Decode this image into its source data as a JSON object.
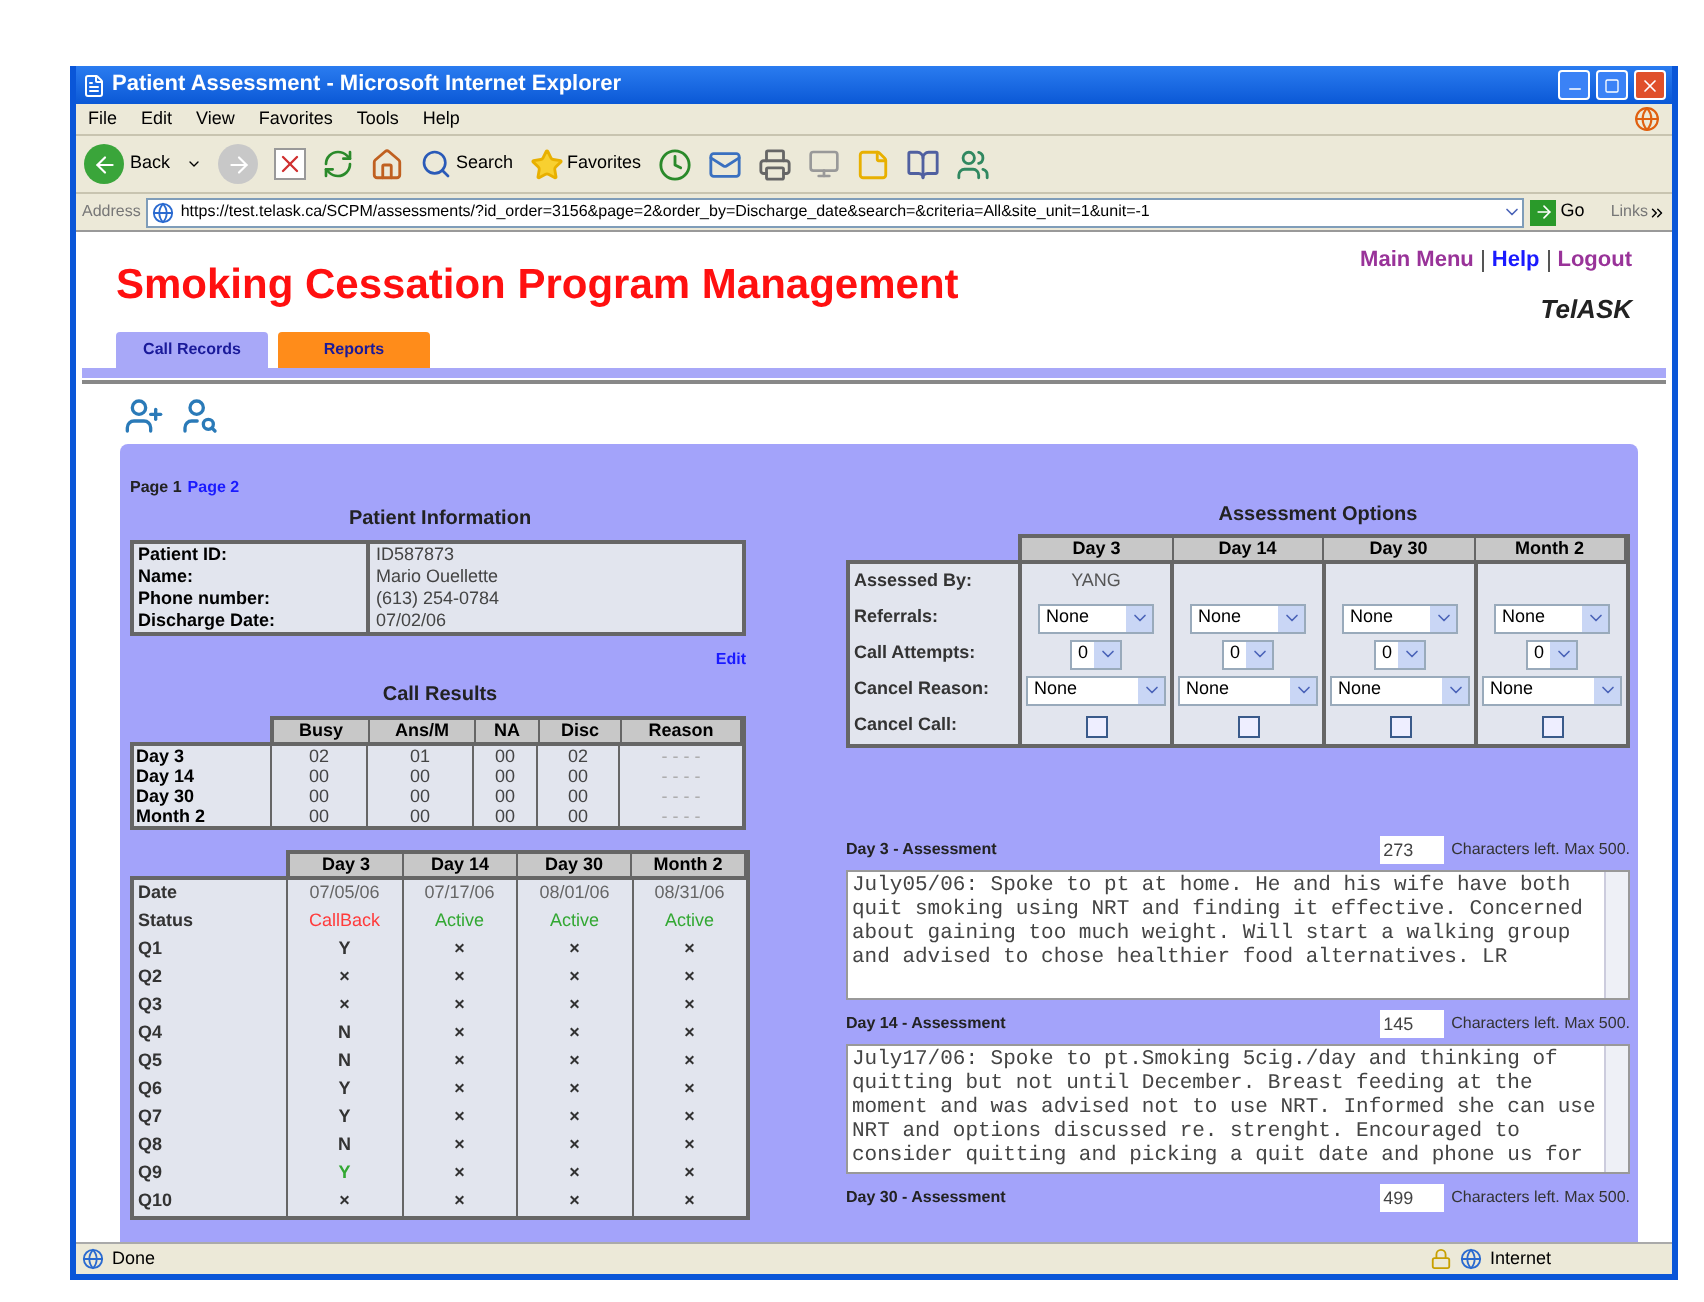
{
  "window": {
    "title": "Patient Assessment - Microsoft Internet Explorer"
  },
  "menu": [
    "File",
    "Edit",
    "View",
    "Favorites",
    "Tools",
    "Help"
  ],
  "toolbar": {
    "back": "Back",
    "search": "Search",
    "favorites": "Favorites"
  },
  "address_bar": {
    "label": "Address",
    "url": "https://test.telask.ca/SCPM/assessments/?id_order=3156&page=2&order_by=Discharge_date&search=&criteria=All&site_unit=1&unit=-1",
    "go": "Go",
    "links": "Links"
  },
  "app": {
    "title": "Smoking Cessation Program Management",
    "links": [
      {
        "label": "Main Menu",
        "visited": true
      },
      {
        "label": "Help",
        "visited": false
      },
      {
        "label": "Logout",
        "visited": true
      }
    ],
    "logo": "TelASK"
  },
  "tabs": [
    {
      "label": "Call Records",
      "selected": true
    },
    {
      "label": "Reports",
      "selected": false
    }
  ],
  "pager": [
    {
      "label": "Page 1",
      "selected": true
    },
    {
      "label": "Page 2",
      "selected": false
    }
  ],
  "patient_info": {
    "title": "Patient Information",
    "fields": [
      {
        "label": "Patient ID:",
        "value": "ID587873"
      },
      {
        "label": "Name:",
        "value": "Mario Ouellette"
      },
      {
        "label": "Phone number:",
        "value": "(613) 254-0784"
      },
      {
        "label": "Discharge Date:",
        "value": "07/02/06"
      }
    ]
  },
  "edit_link": "Edit",
  "call_results": {
    "title": "Call Results",
    "columns": [
      "Busy",
      "Ans/M",
      "NA",
      "Disc",
      "Reason"
    ],
    "rows": [
      {
        "label": "Day 3",
        "cells": [
          "02",
          "01",
          "00",
          "02",
          "- - - -"
        ]
      },
      {
        "label": "Day 14",
        "cells": [
          "00",
          "00",
          "00",
          "00",
          "- - - -"
        ]
      },
      {
        "label": "Day 30",
        "cells": [
          "00",
          "00",
          "00",
          "00",
          "- - - -"
        ]
      },
      {
        "label": "Month 2",
        "cells": [
          "00",
          "00",
          "00",
          "00",
          "- - - -"
        ]
      }
    ]
  },
  "schedule": {
    "columns": [
      "Day 3",
      "Day 14",
      "Day 30",
      "Month 2"
    ],
    "date": {
      "label": "Date",
      "values": [
        "07/05/06",
        "07/17/06",
        "08/01/06",
        "08/31/06"
      ]
    },
    "status": {
      "label": "Status",
      "values": [
        {
          "text": "CallBack",
          "color": "#ff3b3b"
        },
        {
          "text": "Active",
          "color": "#33a833"
        },
        {
          "text": "Active",
          "color": "#33a833"
        },
        {
          "text": "Active",
          "color": "#33a833"
        }
      ]
    },
    "questions": [
      {
        "label": "Q1",
        "answers": [
          "Y",
          "×",
          "×",
          "×"
        ]
      },
      {
        "label": "Q2",
        "answers": [
          "×",
          "×",
          "×",
          "×"
        ]
      },
      {
        "label": "Q3",
        "answers": [
          "×",
          "×",
          "×",
          "×"
        ]
      },
      {
        "label": "Q4",
        "answers": [
          "N",
          "×",
          "×",
          "×"
        ]
      },
      {
        "label": "Q5",
        "answers": [
          "N",
          "×",
          "×",
          "×"
        ]
      },
      {
        "label": "Q6",
        "answers": [
          "Y",
          "×",
          "×",
          "×"
        ]
      },
      {
        "label": "Q7",
        "answers": [
          "Y",
          "×",
          "×",
          "×"
        ]
      },
      {
        "label": "Q8",
        "answers": [
          "N",
          "×",
          "×",
          "×"
        ]
      },
      {
        "label": "Q9",
        "answers": [
          {
            "text": "Y",
            "color": "#33a833"
          },
          "×",
          "×",
          "×"
        ]
      },
      {
        "label": "Q10",
        "answers": [
          "×",
          "×",
          "×",
          "×"
        ]
      }
    ]
  },
  "assessment_options": {
    "title": "Assessment Options",
    "columns": [
      "Day 3",
      "Day 14",
      "Day 30",
      "Month 2"
    ],
    "rows": [
      {
        "kind": "text",
        "label": "Assessed By:",
        "values": [
          "YANG"
        ]
      },
      {
        "kind": "select",
        "label": "Referrals:",
        "values": [
          "None",
          "None",
          "None",
          "None"
        ]
      },
      {
        "kind": "small_select",
        "label": "Call Attempts:",
        "values": [
          "0",
          "0",
          "0",
          "0"
        ]
      },
      {
        "kind": "wide_select",
        "label": "Cancel Reason:",
        "values": [
          "None",
          "None",
          "None",
          "None"
        ]
      },
      {
        "kind": "checkbox",
        "label": "Cancel Call:",
        "values": [
          false,
          false,
          false,
          false
        ]
      }
    ]
  },
  "assessments": [
    {
      "title": "Day 3 - Assessment",
      "remaining": "273",
      "note": "Characters left. Max 500.",
      "text": "July05/06: Spoke to pt at home. He and his wife have both quit smoking using NRT and finding it effective. Concerned about gaining too much weight. Will start a walking group and advised to chose healthier food alternatives. LR"
    },
    {
      "title": "Day 14 - Assessment",
      "remaining": "145",
      "note": "Characters left. Max 500.",
      "text": "July17/06: Spoke to pt.Smoking 5cig./day and thinking of quitting but not until December. Breast feeding at the moment and was advised not to use NRT. Informed she can use NRT and options discussed re. strenght. Encouraged to consider quitting and picking a quit date and phone us for"
    },
    {
      "title": "Day 30 - Assessment",
      "remaining": "499",
      "note": "Characters left. Max 500."
    }
  ],
  "status_bar": {
    "text": "Done",
    "zone": "Internet"
  }
}
